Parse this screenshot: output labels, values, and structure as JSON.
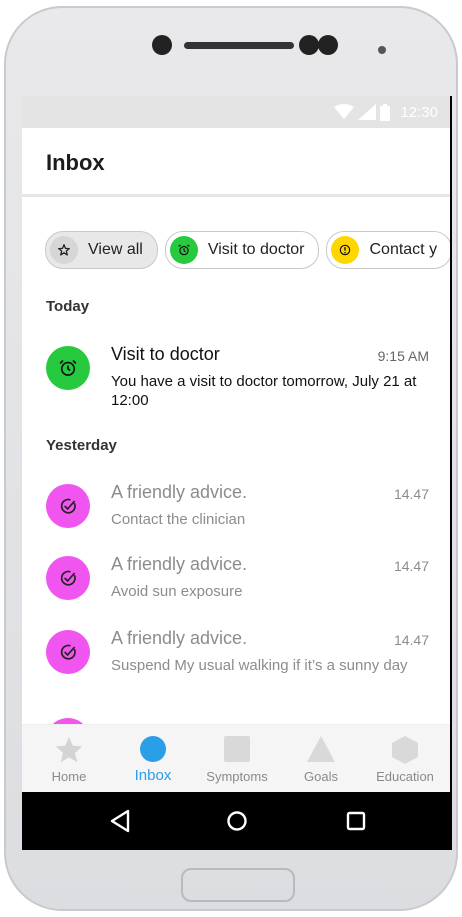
{
  "status_bar": {
    "time": "12:30"
  },
  "header": {
    "title": "Inbox"
  },
  "chips": [
    {
      "label": "View all",
      "icon": "star-icon",
      "color": "#d6d6d6"
    },
    {
      "label": "Visit to doctor",
      "icon": "alarm-clock-icon",
      "color": "#27c93f"
    },
    {
      "label": "Contact y",
      "icon": "alert-icon",
      "color": "#ffd600"
    }
  ],
  "sections": {
    "today": "Today",
    "yesterday": "Yesterday"
  },
  "messages": [
    {
      "title": "Visit to doctor",
      "time": "9:15 AM",
      "body": "You have a visit to doctor tomorrow, July 21 at 12:00",
      "icon": "alarm-clock-icon",
      "color": "#27c93f",
      "unread": true
    },
    {
      "title": "A friendly advice.",
      "time": "14.47",
      "body": "Contact the clinician",
      "icon": "check-circle-icon",
      "color": "#f055f0",
      "unread": false
    },
    {
      "title": "A friendly advice.",
      "time": "14.47",
      "body": "Avoid sun exposure",
      "icon": "check-circle-icon",
      "color": "#f055f0",
      "unread": false
    },
    {
      "title": "A friendly advice.",
      "time": "14.47",
      "body": "Suspend My usual walking if it’s a sunny day",
      "icon": "check-circle-icon",
      "color": "#f055f0",
      "unread": false
    }
  ],
  "tabs": [
    {
      "label": "Home",
      "icon": "star-icon",
      "active": false
    },
    {
      "label": "Inbox",
      "icon": "circle-icon",
      "active": true
    },
    {
      "label": "Symptoms",
      "icon": "square-icon",
      "active": false
    },
    {
      "label": "Goals",
      "icon": "triangle-icon",
      "active": false
    },
    {
      "label": "Education",
      "icon": "hexagon-icon",
      "active": false
    }
  ],
  "colors": {
    "accent": "#2a9ee6",
    "inactive_icon": "#d9d9d9"
  }
}
